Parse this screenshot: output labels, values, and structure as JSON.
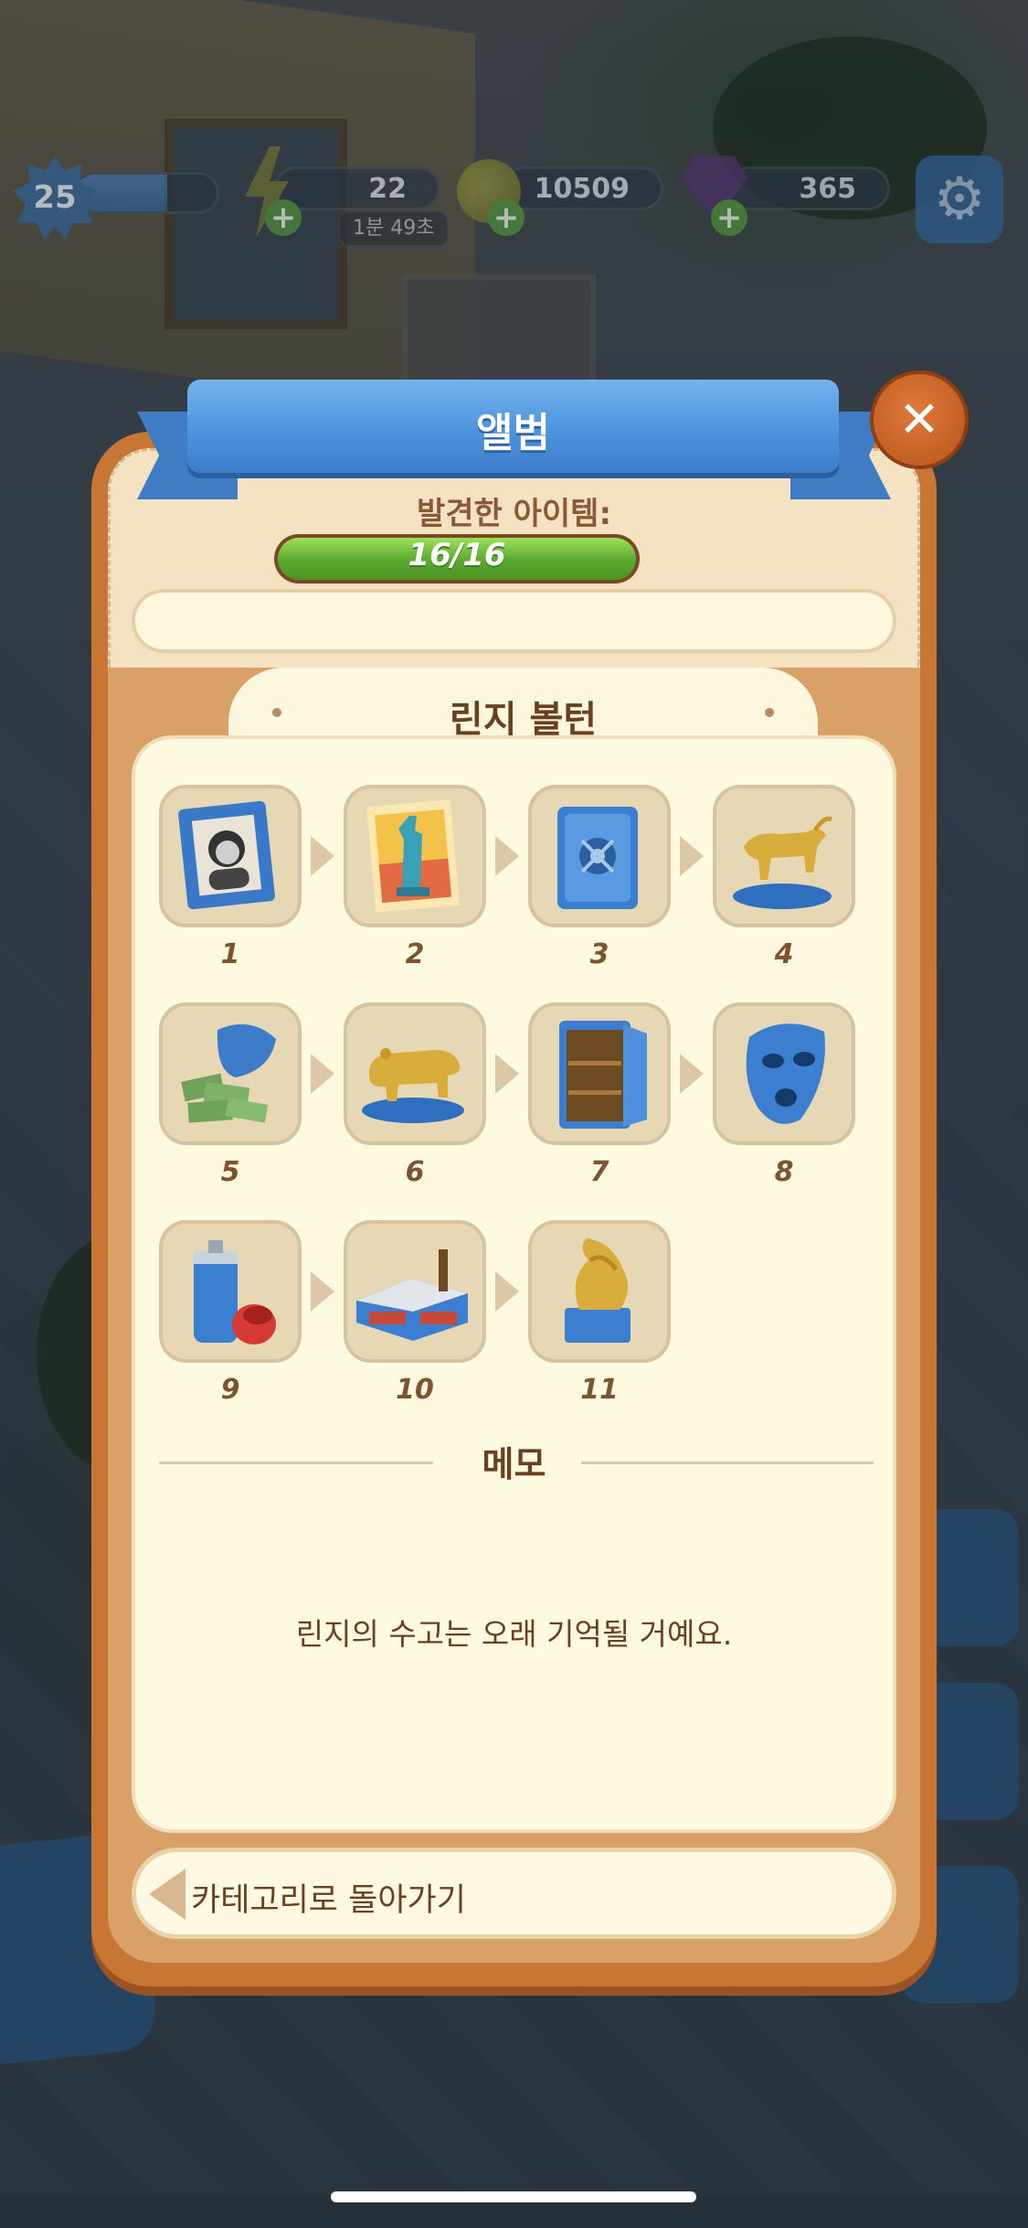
{
  "hud": {
    "level": "25",
    "level_progress": 0.65,
    "energy": "22",
    "energy_timer": "1분 49초",
    "coins": "10509",
    "gems": "365"
  },
  "album": {
    "title": "앨범",
    "found_label": "발견한 아이템:",
    "progress_text": "16/16",
    "progress_fraction": 1.0,
    "collection_title": "린지 볼턴",
    "items": [
      {
        "number": "1",
        "icon": "framed-portrait-icon"
      },
      {
        "number": "2",
        "icon": "statue-of-liberty-poster-icon"
      },
      {
        "number": "3",
        "icon": "safe-closed-icon"
      },
      {
        "number": "4",
        "icon": "golden-bull-statue-icon"
      },
      {
        "number": "5",
        "icon": "money-bag-icon"
      },
      {
        "number": "6",
        "icon": "golden-bear-statue-icon"
      },
      {
        "number": "7",
        "icon": "safe-open-icon"
      },
      {
        "number": "8",
        "icon": "blue-mask-icon"
      },
      {
        "number": "9",
        "icon": "spray-can-icon"
      },
      {
        "number": "10",
        "icon": "factory-icon"
      },
      {
        "number": "11",
        "icon": "golden-award-icon"
      }
    ],
    "memo_title": "메모",
    "memo_text": "린지의 수고는 오래 기억될 거예요.",
    "back_label": "카테고리로 돌아가기",
    "close_symbol": "✕"
  },
  "colors": {
    "ribbon": "#4e94de",
    "panel_frame": "#c87634",
    "progress_green": "#5aa82e",
    "text_brown": "#6b4020"
  }
}
